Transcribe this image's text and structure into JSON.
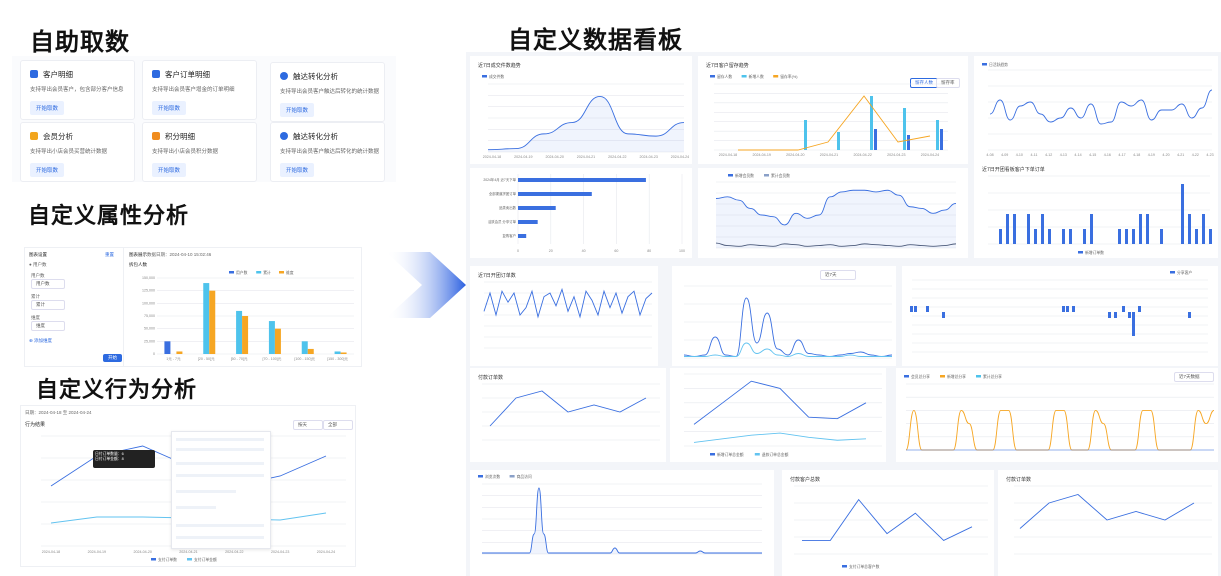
{
  "headings": {
    "self": "自助取数",
    "attr": "自定义属性分析",
    "behav": "自定义行为分析",
    "board": "自定义数据看板"
  },
  "cards": [
    {
      "title": "客户明细",
      "desc": "支持导出会员客户，包含部分客户信息",
      "btn": "开始取数",
      "color": "#2d6ae0"
    },
    {
      "title": "客户订单明细",
      "desc": "支持导出会员客户增金的订单明细",
      "btn": "开始取数",
      "color": "#2d6ae0"
    },
    {
      "title": "触达转化分析",
      "desc": "支持导出会员客户触达后转化的统计数据",
      "btn": "开始取数",
      "color": "#2d6ae0"
    },
    {
      "title": "会员分析",
      "desc": "支持导出小店会员买营统计数据",
      "btn": "开始取数",
      "color": "#f2a51c"
    },
    {
      "title": "积分明细",
      "desc": "支持导出小店会员积分数据",
      "btn": "开始取数",
      "color": "#f08c1e"
    },
    {
      "title": "触达转化分析",
      "desc": "支持导出会员客户触达后转化的统计数据",
      "btn": "开始取数",
      "color": "#2d6ae0"
    }
  ],
  "attr": {
    "left_title": "图表设置",
    "reset": "重置",
    "right_title": "图表展示",
    "date": "数据日期：2024-04-10 15:02:46",
    "subtitle": "拆包人数",
    "btn": "开始",
    "fields": [
      "用户数",
      "累计",
      "维度"
    ],
    "field_values": [
      "用户数",
      "累计",
      "维度"
    ],
    "add": "添加维度",
    "chart_data": {
      "type": "bar",
      "categories": [
        "1元 - 7元",
        "[20 - 50]元",
        "[50 - 70]元",
        "[70 - 100]元",
        "[100 - 150]元",
        "[150 - 300]元"
      ],
      "series": [
        {
          "name": "用户数",
          "color": "#3a6fe0",
          "values": [
            25000,
            0,
            0,
            0,
            0,
            0
          ]
        },
        {
          "name": "累计",
          "color": "#4ec3ec",
          "values": [
            0,
            140000,
            85000,
            65000,
            25000,
            5000
          ]
        },
        {
          "name": "维度",
          "color": "#f6a623",
          "values": [
            5000,
            125000,
            75000,
            50000,
            10000,
            3000
          ]
        }
      ],
      "ylim": [
        0,
        150000
      ],
      "yticks": [
        "0",
        "25,000",
        "50,000",
        "75,000",
        "100,000",
        "125,000",
        "150,000"
      ]
    }
  },
  "behav": {
    "date": "日期：2024-04-18 至 2024-04-24",
    "title": "行为结果",
    "sel1": "按天",
    "sel2": "全部",
    "tooltip": [
      "日付订单数量：6",
      "日付订单金额：8"
    ],
    "xlabels": [
      "2024-04-18",
      "2024-04-19",
      "2024-04-20",
      "2024-04-21",
      "2024-04-22",
      "2024-04-23",
      "2024-04-24"
    ],
    "legend": [
      "支付订单数",
      "支付订单金额"
    ]
  },
  "board": {
    "p1": {
      "title": "近7日成交件数趋势",
      "legend": "成交件数",
      "xlabels": [
        "2024-04-18",
        "2024-04-19",
        "2024-04-20",
        "2024-04-21",
        "2024-04-22",
        "2024-04-23",
        "2024-04-24"
      ]
    },
    "p2": {
      "title": "近7日客户留存趋势",
      "legend": [
        "留存人数",
        "新增人数",
        "留存率(%)"
      ],
      "tabs": [
        "留存人数",
        "留存率"
      ],
      "xlabels": [
        "2024-04-18",
        "2024-04-19",
        "2024-04-20",
        "2024-04-21",
        "2024-04-22",
        "2024-04-23",
        "2024-04-24"
      ]
    },
    "p3": {
      "legend": "日活跃趋势",
      "xlabels": [
        "4-08",
        "4-09",
        "4-10",
        "4-11",
        "4-12",
        "4-13",
        "4-14",
        "4-15",
        "4-16",
        "4-17",
        "4-18",
        "4-19",
        "4-20",
        "4-21",
        "4-22",
        "4-23"
      ]
    },
    "p4": {
      "labels": [
        "2024年4月 近7天下单",
        "全部渠道拼团订单",
        "品类卖出数",
        "活跃会员 分享订单",
        "复购客户"
      ],
      "values": [
        78,
        45,
        23,
        12,
        5
      ],
      "xticks": [
        "0",
        "20",
        "40",
        "60",
        "80",
        "100"
      ]
    },
    "p5": {
      "legend": [
        "新增会员数",
        "累计会员数"
      ]
    },
    "p6": {
      "title": "近7日开团看板客户下单订单",
      "legend": "新增订单数"
    },
    "p7": {
      "title": "近7日开团订单数"
    },
    "p8": {
      "sel": "近7天"
    },
    "p9": {
      "legend": "分享客户"
    },
    "p10": {
      "title": "付款订单数"
    },
    "p11": {
      "legend": [
        "新增订单总金额",
        "退款订单总金额"
      ]
    },
    "p12": {
      "legend": [
        "会员总分享",
        "新增总分享",
        "累计总分享"
      ],
      "sel": "近7天数据"
    },
    "p13": {
      "legend": [
        "浏览次数",
        "商品访问"
      ]
    },
    "p14": {
      "title": "付款客户总数",
      "legend": "支付订单总客户数"
    },
    "p15": {
      "title": "付款订单数"
    }
  }
}
